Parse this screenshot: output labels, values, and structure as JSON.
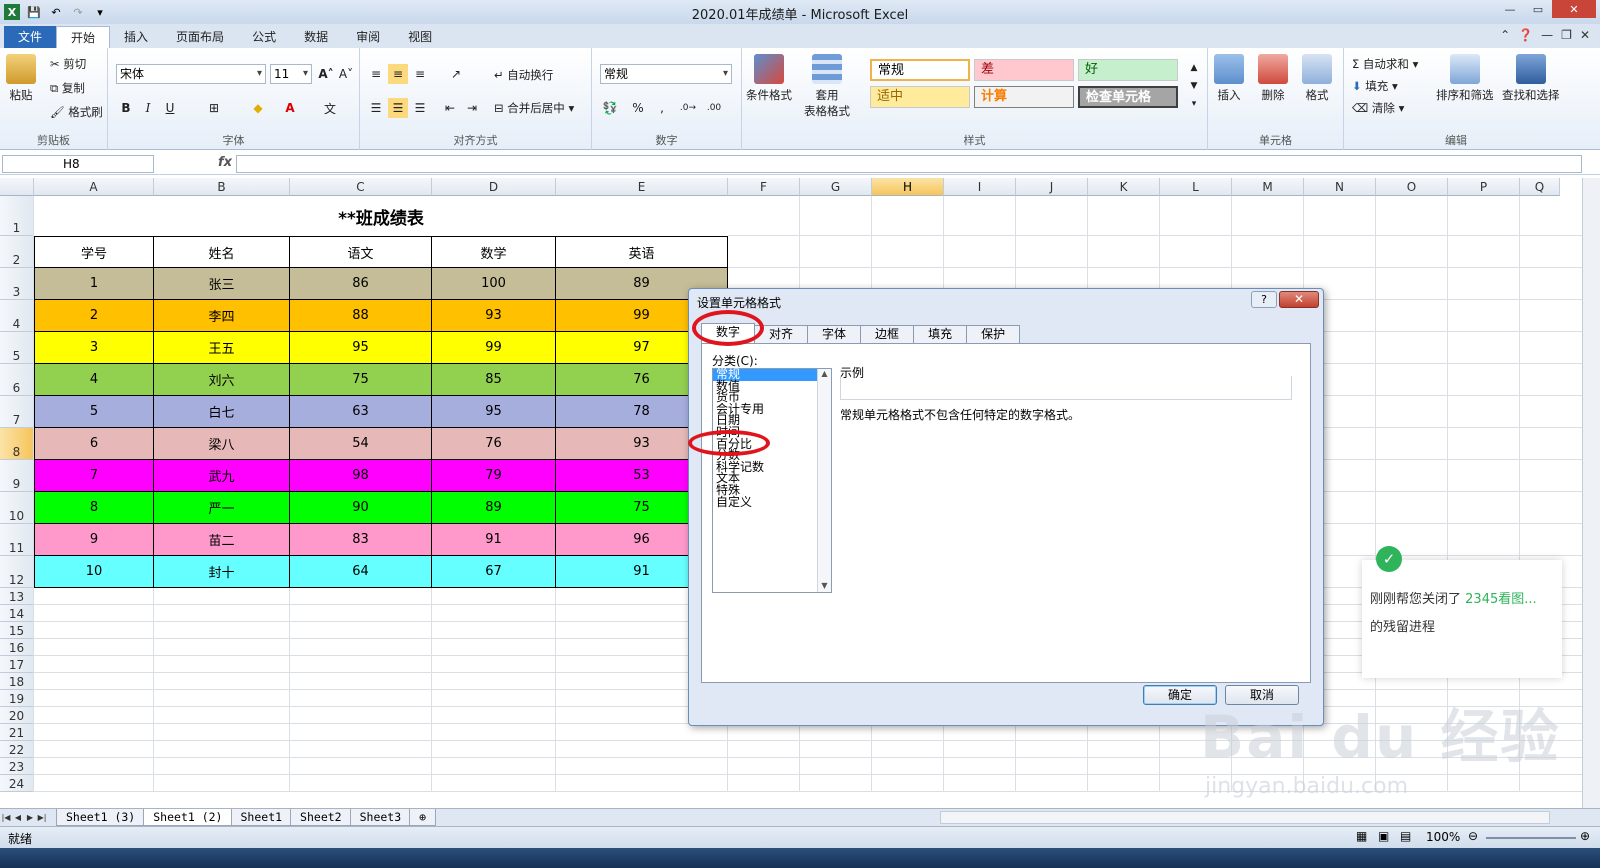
{
  "window": {
    "title": "2020.01年成绩单 - Microsoft Excel"
  },
  "tabs": [
    {
      "label": "文件"
    },
    {
      "label": "开始"
    },
    {
      "label": "插入"
    },
    {
      "label": "页面布局"
    },
    {
      "label": "公式"
    },
    {
      "label": "数据"
    },
    {
      "label": "审阅"
    },
    {
      "label": "视图"
    }
  ],
  "ribbon": {
    "clipboard": {
      "label": "剪贴板",
      "paste": "粘贴",
      "cut": "剪切",
      "copy": "复制",
      "format_painter": "格式刷"
    },
    "font": {
      "label": "字体",
      "name": "宋体",
      "size": "11"
    },
    "alignment": {
      "label": "对齐方式",
      "wrap": "自动换行",
      "merge": "合并后居中"
    },
    "number": {
      "label": "数字",
      "format": "常规"
    },
    "styles": {
      "label": "样式",
      "conditional": "条件格式",
      "table": "套用",
      "table2": "表格格式",
      "normal": "常规",
      "bad": "差",
      "good": "好",
      "neutral": "适中",
      "calc": "计算",
      "check": "检查单元格"
    },
    "cells": {
      "label": "单元格",
      "insert": "插入",
      "delete": "删除",
      "format": "格式"
    },
    "editing": {
      "label": "编辑",
      "autosum": "自动求和",
      "fill": "填充",
      "clear": "清除",
      "sort": "排序和筛选",
      "find": "查找和选择"
    }
  },
  "formula_bar": {
    "name_box": "H8",
    "fx": "fx"
  },
  "columns": [
    "A",
    "B",
    "C",
    "D",
    "E",
    "F",
    "G",
    "H",
    "I",
    "J",
    "K",
    "L",
    "M",
    "N",
    "O",
    "P",
    "Q"
  ],
  "rows": [
    "1",
    "2",
    "3",
    "4",
    "5",
    "6",
    "7",
    "8",
    "9",
    "10",
    "11",
    "12",
    "13",
    "14",
    "15",
    "16",
    "17",
    "18",
    "19",
    "20",
    "21",
    "22",
    "23",
    "24"
  ],
  "sheet": {
    "title": "**班成绩表",
    "headers": [
      "学号",
      "姓名",
      "语文",
      "数学",
      "英语"
    ],
    "data": [
      {
        "cells": [
          "1",
          "张三",
          "86",
          "100",
          "89"
        ],
        "color": "#c4bd97"
      },
      {
        "cells": [
          "2",
          "李四",
          "88",
          "93",
          "99"
        ],
        "color": "#ffc000"
      },
      {
        "cells": [
          "3",
          "王五",
          "95",
          "99",
          "97"
        ],
        "color": "#ffff00"
      },
      {
        "cells": [
          "4",
          "刘六",
          "75",
          "85",
          "76"
        ],
        "color": "#92d050"
      },
      {
        "cells": [
          "5",
          "白七",
          "63",
          "95",
          "78"
        ],
        "color": "#a6aede"
      },
      {
        "cells": [
          "6",
          "梁八",
          "54",
          "76",
          "93"
        ],
        "color": "#e6b9b8"
      },
      {
        "cells": [
          "7",
          "武九",
          "98",
          "79",
          "53"
        ],
        "color": "#ff00ff"
      },
      {
        "cells": [
          "8",
          "严一",
          "90",
          "89",
          "75"
        ],
        "color": "#00ff00"
      },
      {
        "cells": [
          "9",
          "苗二",
          "83",
          "91",
          "96"
        ],
        "color": "#ff99cc"
      },
      {
        "cells": [
          "10",
          "封十",
          "64",
          "67",
          "91"
        ],
        "color": "#66ffff"
      }
    ]
  },
  "sheet_tabs": [
    "Sheet1 (3)",
    "Sheet1 (2)",
    "Sheet1",
    "Sheet2",
    "Sheet3"
  ],
  "status": {
    "ready": "就绪",
    "zoom": "100%"
  },
  "dialog": {
    "title": "设置单元格格式",
    "help": "?",
    "close": "✕",
    "tabs": [
      "数字",
      "对齐",
      "字体",
      "边框",
      "填充",
      "保护"
    ],
    "category_label": "分类(C):",
    "categories": [
      "常规",
      "数值",
      "货币",
      "会计专用",
      "日期",
      "时间",
      "百分比",
      "分数",
      "科学记数",
      "文本",
      "特殊",
      "自定义"
    ],
    "sample_label": "示例",
    "description": "常规单元格格式不包含任何特定的数字格式。",
    "ok": "确定",
    "cancel": "取消"
  },
  "toast": {
    "line1": "刚刚帮您关闭了",
    "highlight": "2345看图...",
    "line2": "的残留进程"
  },
  "watermark": {
    "text": "Bai du 经验",
    "url": "jingyan.baidu.com"
  }
}
